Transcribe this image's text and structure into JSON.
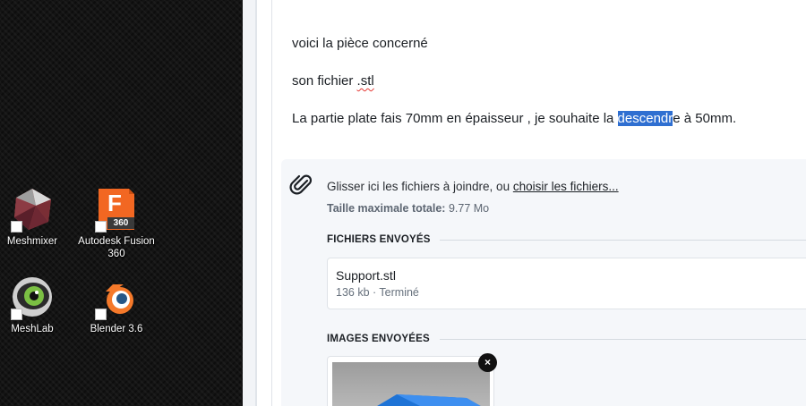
{
  "desktop": {
    "icons": [
      {
        "label": "Meshmixer",
        "icon": "meshmixer-icon"
      },
      {
        "label": "Autodesk Fusion 360",
        "icon": "fusion-360-icon",
        "badge": "360",
        "letter": "F"
      },
      {
        "label": "MeshLab",
        "icon": "meshlab-icon"
      },
      {
        "label": "Blender 3.6",
        "icon": "blender-icon"
      }
    ]
  },
  "message": {
    "line1": "voici la pièce concerné",
    "line2_prefix": "son fichier ",
    "line2_misspelled": ".stl",
    "line3_before": "La partie plate fais 70mm en épaisseur , je souhaite la ",
    "line3_selected": "descendr",
    "line3_after": "e à 50mm."
  },
  "upload": {
    "drop_text": "Glisser ici les fichiers à joindre, ou ",
    "drop_link": "choisir les fichiers...",
    "max_label": "Taille maximale totale:",
    "max_value": " 9.77 Mo"
  },
  "files_section": {
    "title": "FICHIERS ENVOYÉS",
    "files": [
      {
        "name": "Support.stl",
        "meta": "136 kb · Terminé"
      }
    ]
  },
  "images_section": {
    "title": "IMAGES ENVOYÉES",
    "remove_label": "×"
  },
  "colors": {
    "selection": "#2f6fd1",
    "fusion_orange": "#f26722",
    "blender_orange": "#f5792a"
  }
}
